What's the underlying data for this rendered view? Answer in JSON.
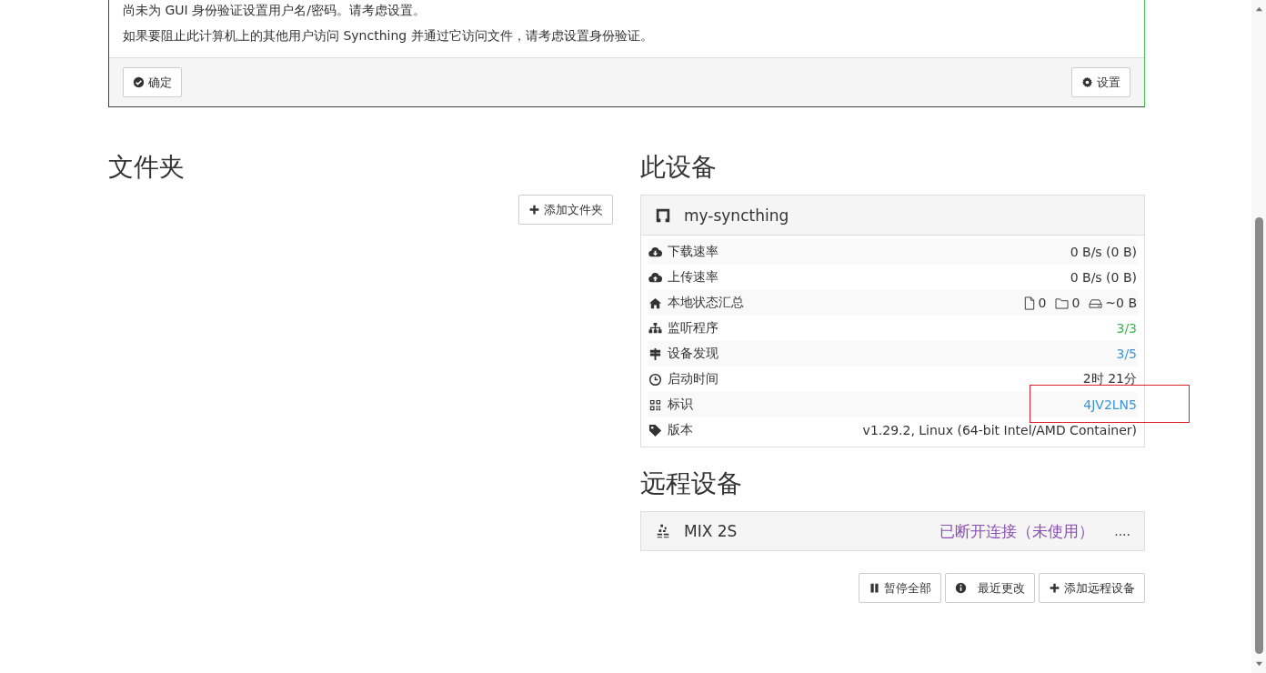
{
  "notice": {
    "paragraphs": [
      "尚未为 GUI 身份验证设置用户名/密码。请考虑设置。",
      "如果要阻止此计算机上的其他用户访问 Syncthing 并通过它访问文件，请考虑设置身份验证。"
    ],
    "ok_button": "确定",
    "settings_button": "设置"
  },
  "folders": {
    "title": "文件夹",
    "add_button": "添加文件夹"
  },
  "this_device": {
    "title": "此设备",
    "name": "my-syncthing",
    "stats": [
      {
        "label": "下载速率",
        "value": "0 B/s (0 B)",
        "highlighted": false
      },
      {
        "label": "上传速率",
        "value": "0 B/s (0 B)",
        "highlighted": false
      },
      {
        "label": "本地状态汇总",
        "kind": "summary",
        "files": "0",
        "folders": "0",
        "size": "~0 B",
        "highlighted": false
      },
      {
        "label": "监听程序",
        "value": "3/3",
        "color": "#3fb34f",
        "highlighted": false
      },
      {
        "label": "设备发现",
        "value": "3/5",
        "color": "#3d95d8",
        "highlighted": false
      },
      {
        "label": "启动时间",
        "value": "2时 21分",
        "highlighted": false
      },
      {
        "label": "标识",
        "value": "4JV2LN5",
        "color": "#3d95d8",
        "highlighted": true
      },
      {
        "label": "版本",
        "value": "v1.29.2, Linux (64-bit Intel/AMD Container)",
        "highlighted": false
      }
    ]
  },
  "remote_devices": {
    "title": "远程设备",
    "devices": [
      {
        "name": "MIX 2S",
        "status": "已断开连接（未使用）",
        "color": "#8c4fb4",
        "extra": "...."
      }
    ],
    "buttons": [
      {
        "label": "暂停全部"
      },
      {
        "label": "最近更改"
      },
      {
        "label": "添加远程设备"
      }
    ]
  }
}
